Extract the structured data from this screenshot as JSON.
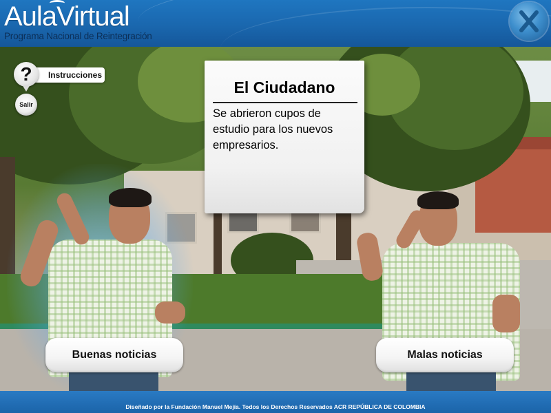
{
  "header": {
    "logo_title": "AulaVirtual",
    "logo_subtitle": "Programa Nacional de Reintegración",
    "close_icon": "close-x-icon",
    "colors": {
      "header_blue": "#1a67ae",
      "footer_blue": "#1b64a9"
    }
  },
  "controls": {
    "instructions_label": "Instrucciones",
    "instructions_icon": "question-mark-icon",
    "exit_label": "Salir"
  },
  "newspaper": {
    "title": "El Ciudadano",
    "body": "Se abrieron cupos de estudio para los nuevos empresarios."
  },
  "answers": {
    "good_label": "Buenas noticias",
    "bad_label": "Malas noticias"
  },
  "footer": {
    "text": "Diseñado por la Fundación Manuel Mejía. Todos los Derechos Reservados ACR REPÚBLICA DE COLOMBIA"
  }
}
